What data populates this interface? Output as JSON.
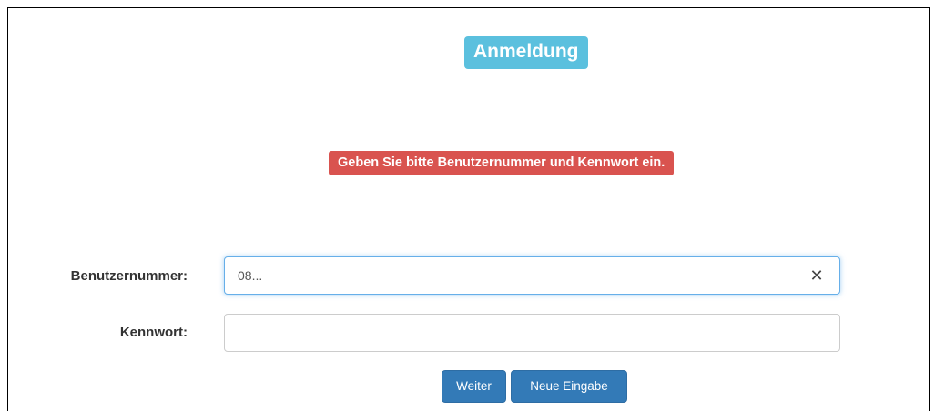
{
  "header": {
    "title": "Anmeldung"
  },
  "alert": {
    "message": "Geben Sie bitte Benutzernummer und Kennwort ein."
  },
  "form": {
    "user_label": "Benutzernummer:",
    "user_value": "08...",
    "password_label": "Kennwort:",
    "password_value": "",
    "clear_icon": "close-icon"
  },
  "buttons": {
    "next_label": "Weiter",
    "reset_label": "Neue Eingabe"
  },
  "colors": {
    "title_bg": "#5bc0de",
    "alert_bg": "#d9534f",
    "button_bg": "#337ab7",
    "focus_border": "#66afe9"
  }
}
